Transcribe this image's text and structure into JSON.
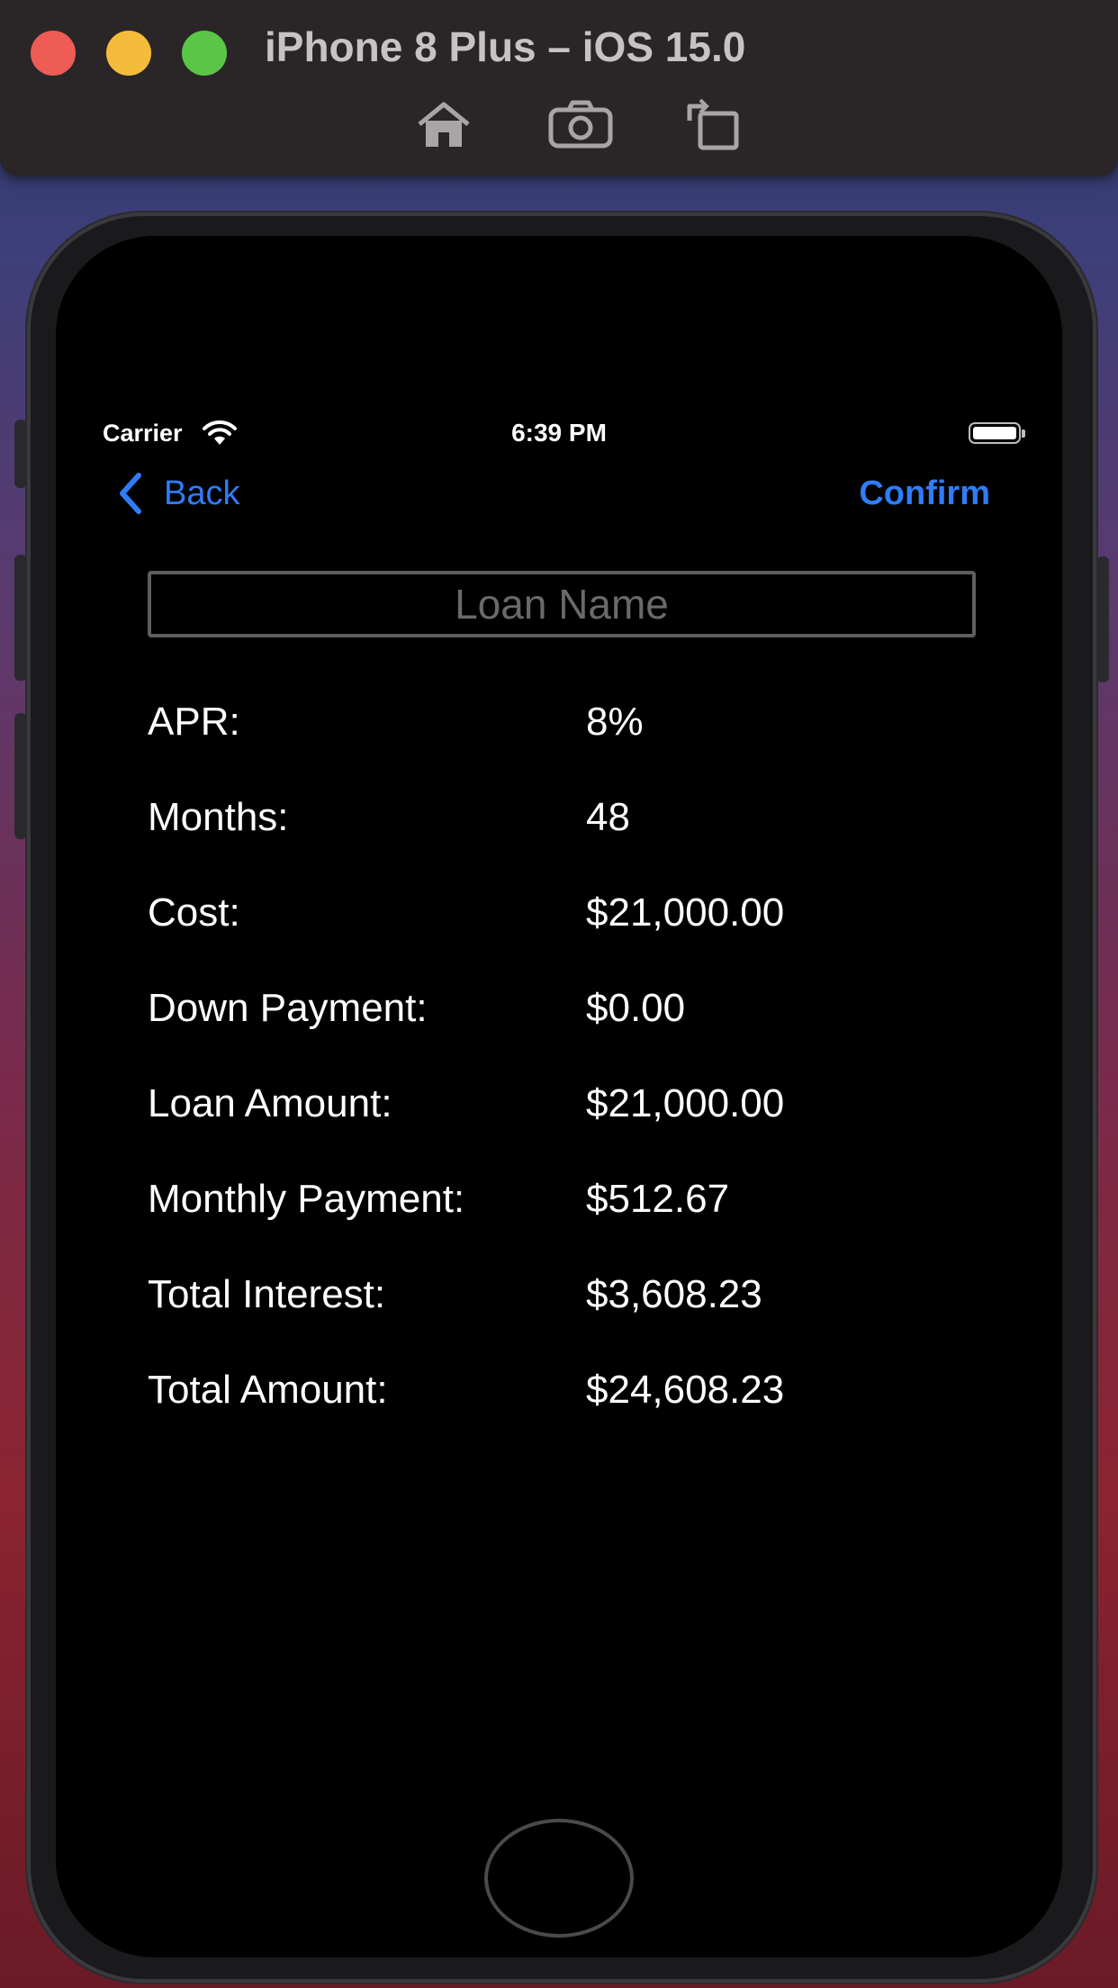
{
  "simulator": {
    "title": "iPhone 8 Plus – iOS 15.0",
    "toolbar": [
      {
        "name": "home",
        "icon": "home-icon"
      },
      {
        "name": "screenshot",
        "icon": "camera-icon"
      },
      {
        "name": "rotate",
        "icon": "rotate-icon"
      }
    ]
  },
  "status_bar": {
    "carrier": "Carrier",
    "time": "6:39 PM"
  },
  "nav": {
    "back_label": "Back",
    "confirm_label": "Confirm",
    "accent_color": "#2f7cf6"
  },
  "form": {
    "loan_name_placeholder": "Loan Name",
    "loan_name_value": ""
  },
  "details": {
    "rows": [
      {
        "label": "APR:",
        "value": "8%"
      },
      {
        "label": "Months:",
        "value": "48"
      },
      {
        "label": "Cost:",
        "value": "$21,000.00"
      },
      {
        "label": "Down Payment:",
        "value": "$0.00"
      },
      {
        "label": "Loan Amount:",
        "value": "$21,000.00"
      },
      {
        "label": "Monthly Payment:",
        "value": "$512.67"
      },
      {
        "label": "Total Interest:",
        "value": "$3,608.23"
      },
      {
        "label": "Total Amount:",
        "value": "$24,608.23"
      }
    ]
  }
}
